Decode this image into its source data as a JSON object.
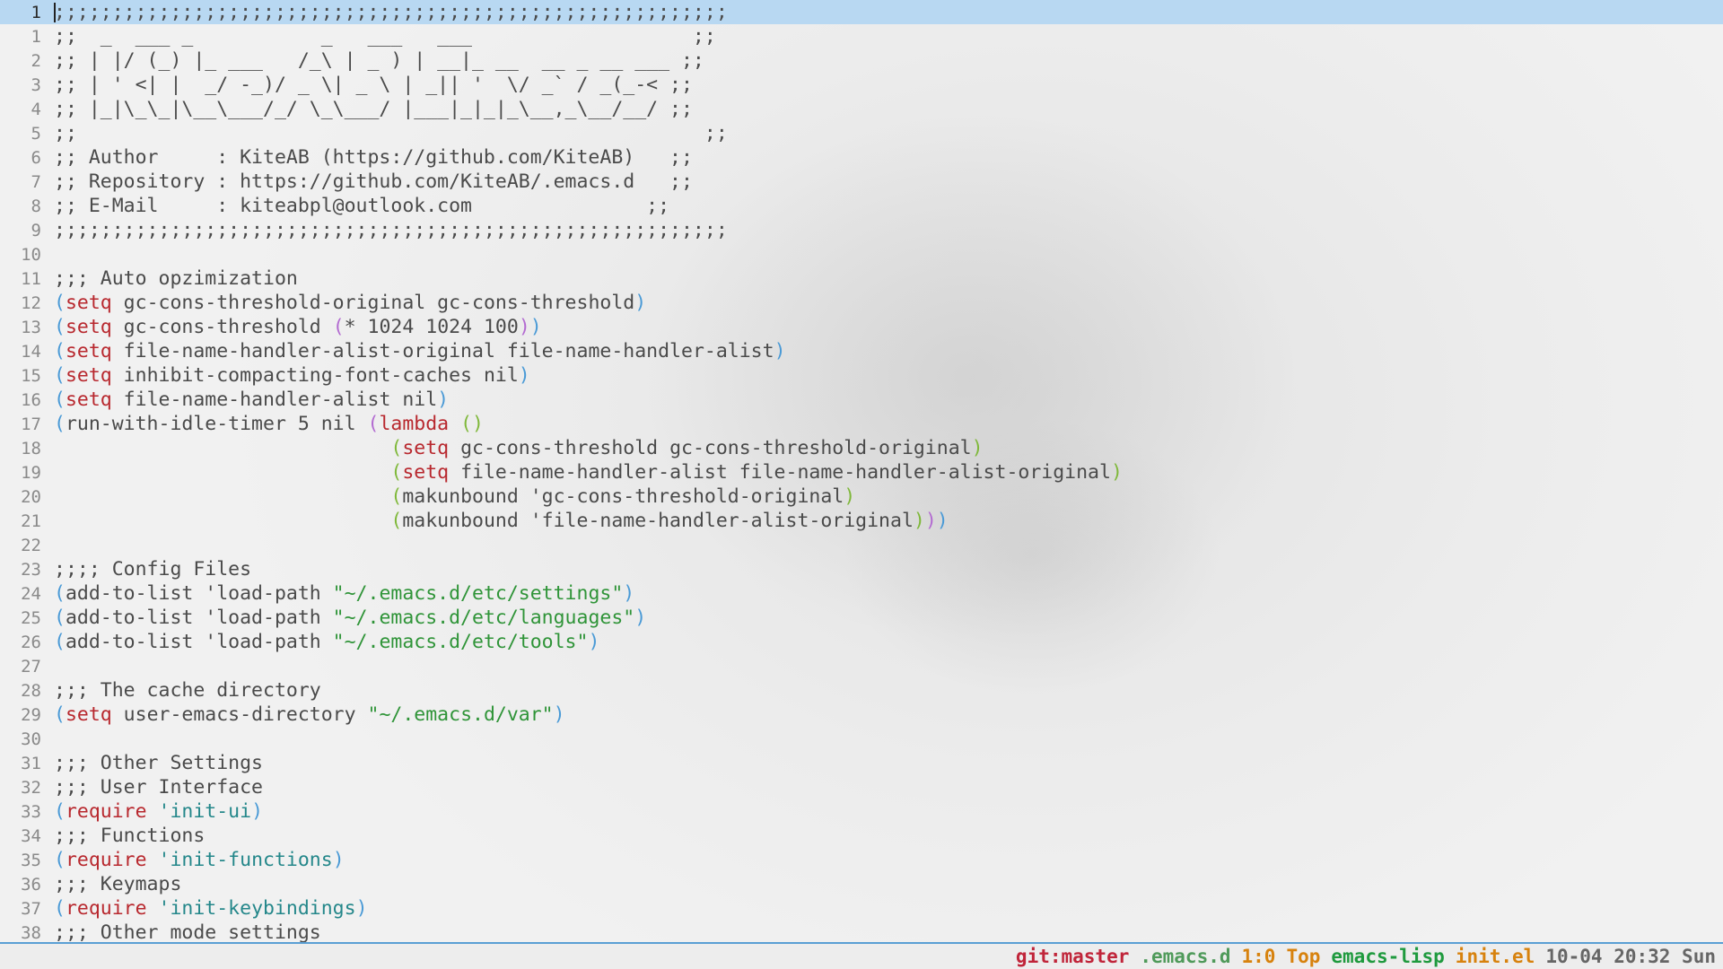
{
  "editor": {
    "lines": [
      {
        "num": "1",
        "current": true,
        "tokens": [
          {
            "t": ";;;;;;;;;;;;;;;;;;;;;;;;;;;;;;;;;;;;;;;;;;;;;;;;;;;;;;;;;;",
            "c": "comment"
          }
        ]
      },
      {
        "num": "1",
        "tokens": [
          {
            "t": ";;  _  ___ _           _   ___   ___                   ;;",
            "c": "comment"
          }
        ]
      },
      {
        "num": "2",
        "tokens": [
          {
            "t": ";; | |/ (_) |_ ___   /_\\ | _ ) | __|_ __  __ _ __ ___ ;;",
            "c": "comment"
          }
        ]
      },
      {
        "num": "3",
        "tokens": [
          {
            "t": ";; | ' <| |  _/ -_)/ _ \\| _ \\ | _|| '  \\/ _` / _(_-< ;;",
            "c": "comment"
          }
        ]
      },
      {
        "num": "4",
        "tokens": [
          {
            "t": ";; |_|\\_\\_|\\__\\___/_/ \\_\\___/ |___|_|_|_\\__,_\\__/__/ ;;",
            "c": "comment"
          }
        ]
      },
      {
        "num": "5",
        "tokens": [
          {
            "t": ";;                                                      ;;",
            "c": "comment"
          }
        ]
      },
      {
        "num": "6",
        "tokens": [
          {
            "t": ";; Author     : KiteAB (https://github.com/KiteAB)   ;;",
            "c": "comment"
          }
        ]
      },
      {
        "num": "7",
        "tokens": [
          {
            "t": ";; Repository : https://github.com/KiteAB/.emacs.d   ;;",
            "c": "comment"
          }
        ]
      },
      {
        "num": "8",
        "tokens": [
          {
            "t": ";; E-Mail     : kiteabpl@outlook.com               ;;",
            "c": "comment"
          }
        ]
      },
      {
        "num": "9",
        "tokens": [
          {
            "t": ";;;;;;;;;;;;;;;;;;;;;;;;;;;;;;;;;;;;;;;;;;;;;;;;;;;;;;;;;;",
            "c": "comment"
          }
        ]
      },
      {
        "num": "10",
        "tokens": []
      },
      {
        "num": "11",
        "tokens": [
          {
            "t": ";;; Auto opzimization",
            "c": "comment"
          }
        ]
      },
      {
        "num": "12",
        "tokens": [
          {
            "t": "(",
            "c": "paren1"
          },
          {
            "t": "setq",
            "c": "keyword"
          },
          {
            "t": " gc-cons-threshold-original gc-cons-threshold",
            "c": "plain"
          },
          {
            "t": ")",
            "c": "paren1"
          }
        ]
      },
      {
        "num": "13",
        "tokens": [
          {
            "t": "(",
            "c": "paren1"
          },
          {
            "t": "setq",
            "c": "keyword"
          },
          {
            "t": " gc-cons-threshold ",
            "c": "plain"
          },
          {
            "t": "(",
            "c": "paren2"
          },
          {
            "t": "* 1024 1024 100",
            "c": "plain"
          },
          {
            "t": ")",
            "c": "paren2"
          },
          {
            "t": ")",
            "c": "paren1"
          }
        ]
      },
      {
        "num": "14",
        "tokens": [
          {
            "t": "(",
            "c": "paren1"
          },
          {
            "t": "setq",
            "c": "keyword"
          },
          {
            "t": " file-name-handler-alist-original file-name-handler-alist",
            "c": "plain"
          },
          {
            "t": ")",
            "c": "paren1"
          }
        ]
      },
      {
        "num": "15",
        "tokens": [
          {
            "t": "(",
            "c": "paren1"
          },
          {
            "t": "setq",
            "c": "keyword"
          },
          {
            "t": " inhibit-compacting-font-caches nil",
            "c": "plain"
          },
          {
            "t": ")",
            "c": "paren1"
          }
        ]
      },
      {
        "num": "16",
        "tokens": [
          {
            "t": "(",
            "c": "paren1"
          },
          {
            "t": "setq",
            "c": "keyword"
          },
          {
            "t": " file-name-handler-alist nil",
            "c": "plain"
          },
          {
            "t": ")",
            "c": "paren1"
          }
        ]
      },
      {
        "num": "17",
        "tokens": [
          {
            "t": "(",
            "c": "paren1"
          },
          {
            "t": "run-with-idle-timer 5 nil ",
            "c": "plain"
          },
          {
            "t": "(",
            "c": "paren2"
          },
          {
            "t": "lambda",
            "c": "keyword"
          },
          {
            "t": " ",
            "c": "plain"
          },
          {
            "t": "()",
            "c": "paren3"
          }
        ]
      },
      {
        "num": "18",
        "tokens": [
          {
            "t": "                             ",
            "c": "plain"
          },
          {
            "t": "(",
            "c": "paren3"
          },
          {
            "t": "setq",
            "c": "keyword"
          },
          {
            "t": " gc-cons-threshold gc-cons-threshold-original",
            "c": "plain"
          },
          {
            "t": ")",
            "c": "paren3"
          }
        ]
      },
      {
        "num": "19",
        "tokens": [
          {
            "t": "                             ",
            "c": "plain"
          },
          {
            "t": "(",
            "c": "paren3"
          },
          {
            "t": "setq",
            "c": "keyword"
          },
          {
            "t": " file-name-handler-alist file-name-handler-alist-original",
            "c": "plain"
          },
          {
            "t": ")",
            "c": "paren3"
          }
        ]
      },
      {
        "num": "20",
        "tokens": [
          {
            "t": "                             ",
            "c": "plain"
          },
          {
            "t": "(",
            "c": "paren3"
          },
          {
            "t": "makunbound 'gc-cons-threshold-original",
            "c": "plain"
          },
          {
            "t": ")",
            "c": "paren3"
          }
        ]
      },
      {
        "num": "21",
        "tokens": [
          {
            "t": "                             ",
            "c": "plain"
          },
          {
            "t": "(",
            "c": "paren3"
          },
          {
            "t": "makunbound 'file-name-handler-alist-original",
            "c": "plain"
          },
          {
            "t": ")",
            "c": "paren3"
          },
          {
            "t": ")",
            "c": "paren2"
          },
          {
            "t": ")",
            "c": "paren1"
          }
        ]
      },
      {
        "num": "22",
        "tokens": []
      },
      {
        "num": "23",
        "tokens": [
          {
            "t": ";;;; Config Files",
            "c": "comment"
          }
        ]
      },
      {
        "num": "24",
        "tokens": [
          {
            "t": "(",
            "c": "paren1"
          },
          {
            "t": "add-to-list 'load-path ",
            "c": "plain"
          },
          {
            "t": "\"~/.emacs.d/etc/settings\"",
            "c": "string"
          },
          {
            "t": ")",
            "c": "paren1"
          }
        ]
      },
      {
        "num": "25",
        "tokens": [
          {
            "t": "(",
            "c": "paren1"
          },
          {
            "t": "add-to-list 'load-path ",
            "c": "plain"
          },
          {
            "t": "\"~/.emacs.d/etc/languages\"",
            "c": "string"
          },
          {
            "t": ")",
            "c": "paren1"
          }
        ]
      },
      {
        "num": "26",
        "tokens": [
          {
            "t": "(",
            "c": "paren1"
          },
          {
            "t": "add-to-list 'load-path ",
            "c": "plain"
          },
          {
            "t": "\"~/.emacs.d/etc/tools\"",
            "c": "string"
          },
          {
            "t": ")",
            "c": "paren1"
          }
        ]
      },
      {
        "num": "27",
        "tokens": []
      },
      {
        "num": "28",
        "tokens": [
          {
            "t": ";;; The cache directory",
            "c": "comment"
          }
        ]
      },
      {
        "num": "29",
        "tokens": [
          {
            "t": "(",
            "c": "paren1"
          },
          {
            "t": "setq",
            "c": "keyword"
          },
          {
            "t": " user-emacs-directory ",
            "c": "plain"
          },
          {
            "t": "\"~/.emacs.d/var\"",
            "c": "string"
          },
          {
            "t": ")",
            "c": "paren1"
          }
        ]
      },
      {
        "num": "30",
        "tokens": []
      },
      {
        "num": "31",
        "tokens": [
          {
            "t": ";;; Other Settings",
            "c": "comment"
          }
        ]
      },
      {
        "num": "32",
        "tokens": [
          {
            "t": ";;; User Interface",
            "c": "comment"
          }
        ]
      },
      {
        "num": "33",
        "tokens": [
          {
            "t": "(",
            "c": "paren1"
          },
          {
            "t": "require",
            "c": "keyword"
          },
          {
            "t": " ",
            "c": "plain"
          },
          {
            "t": "'init-ui",
            "c": "symbol"
          },
          {
            "t": ")",
            "c": "paren1"
          }
        ]
      },
      {
        "num": "34",
        "tokens": [
          {
            "t": ";;; Functions",
            "c": "comment"
          }
        ]
      },
      {
        "num": "35",
        "tokens": [
          {
            "t": "(",
            "c": "paren1"
          },
          {
            "t": "require",
            "c": "keyword"
          },
          {
            "t": " ",
            "c": "plain"
          },
          {
            "t": "'init-functions",
            "c": "symbol"
          },
          {
            "t": ")",
            "c": "paren1"
          }
        ]
      },
      {
        "num": "36",
        "tokens": [
          {
            "t": ";;; Keymaps",
            "c": "comment"
          }
        ]
      },
      {
        "num": "37",
        "tokens": [
          {
            "t": "(",
            "c": "paren1"
          },
          {
            "t": "require",
            "c": "keyword"
          },
          {
            "t": " ",
            "c": "plain"
          },
          {
            "t": "'init-keybindings",
            "c": "symbol"
          },
          {
            "t": ")",
            "c": "paren1"
          }
        ]
      },
      {
        "num": "38",
        "tokens": [
          {
            "t": ";;; Other mode settings",
            "c": "comment"
          }
        ]
      }
    ]
  },
  "modeline": {
    "git_branch": "git:master",
    "project": ".emacs.d",
    "position": "1:0",
    "scroll": "Top",
    "major_mode": "emacs-lisp",
    "filename": "init.el",
    "datetime": "10-04 20:32 Sun"
  },
  "colors": {
    "keyword": "#b8282e",
    "string": "#2f9438",
    "symbol": "#24878a",
    "paren_depth_1": "#4a9ad6",
    "paren_depth_2": "#b36bd1",
    "paren_depth_3": "#7fb83a",
    "current_line_highlight": "#b8d8f2",
    "modeline_border": "#5a9fd4"
  }
}
